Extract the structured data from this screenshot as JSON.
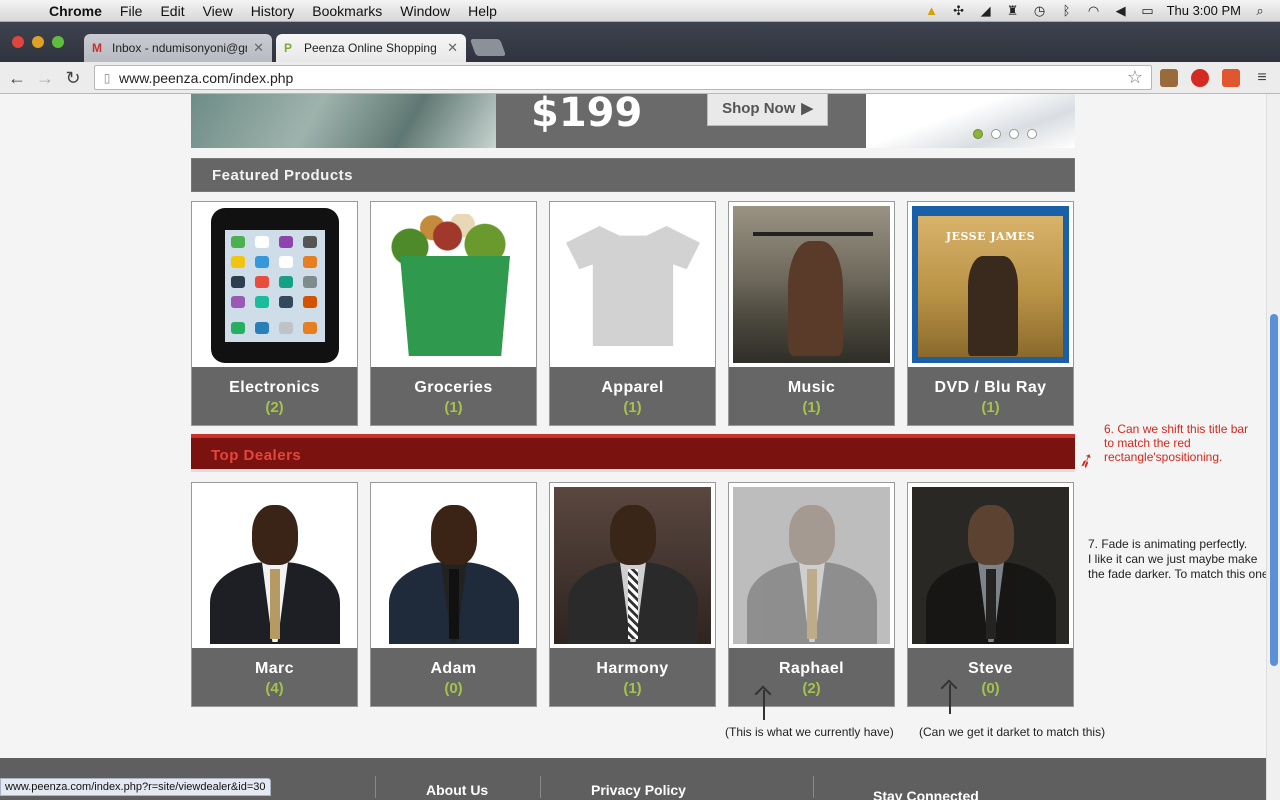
{
  "menubar": {
    "app": "Chrome",
    "items": [
      "File",
      "Edit",
      "View",
      "History",
      "Bookmarks",
      "Window",
      "Help"
    ],
    "clock": "Thu 3:00 PM"
  },
  "tabs": [
    {
      "title": "Inbox - ndumisonyoni@gm",
      "icon": "gmail-icon"
    },
    {
      "title": "Peenza Online Shopping E",
      "icon": "peenza-icon"
    }
  ],
  "toolbar": {
    "url": "www.peenza.com/index.php"
  },
  "banner": {
    "price": "$199",
    "shop_label": "Shop Now"
  },
  "featured": {
    "title": "Featured Products",
    "items": [
      {
        "name": "Electronics",
        "count": "(2)"
      },
      {
        "name": "Groceries",
        "count": "(1)"
      },
      {
        "name": "Apparel",
        "count": "(1)"
      },
      {
        "name": "Music",
        "count": "(1)"
      },
      {
        "name": "DVD / Blu Ray",
        "count": "(1)"
      }
    ],
    "dvd_cover_title": "JESSE JAMES"
  },
  "dealers": {
    "title": "Top Dealers",
    "items": [
      {
        "name": "Marc",
        "count": "(4)"
      },
      {
        "name": "Adam",
        "count": "(0)"
      },
      {
        "name": "Harmony",
        "count": "(1)"
      },
      {
        "name": "Raphael",
        "count": "(2)"
      },
      {
        "name": "Steve",
        "count": "(0)"
      }
    ]
  },
  "annotations": {
    "note6": "6. Can we shift this title bar to match the red rectangle'spositioning.",
    "note7_line1": "7. Fade is animating perfectly.",
    "note7_line2": "I like it can we just maybe make",
    "note7_line3": "the fade darker. To match this one.",
    "caption_current": "(This is what we currently have)",
    "caption_target": "(Can we get it darket to match this)"
  },
  "footer": {
    "links": [
      "About Us",
      "Privacy Policy",
      "Stay Connected"
    ]
  },
  "status_url": "www.peenza.com/index.php?r=site/viewdealer&id=30",
  "colors": {
    "accent_green": "#a6c24a",
    "dealer_bar": "#7a130f",
    "dealer_title": "#e3463c",
    "annotation_red": "#d3281e"
  }
}
